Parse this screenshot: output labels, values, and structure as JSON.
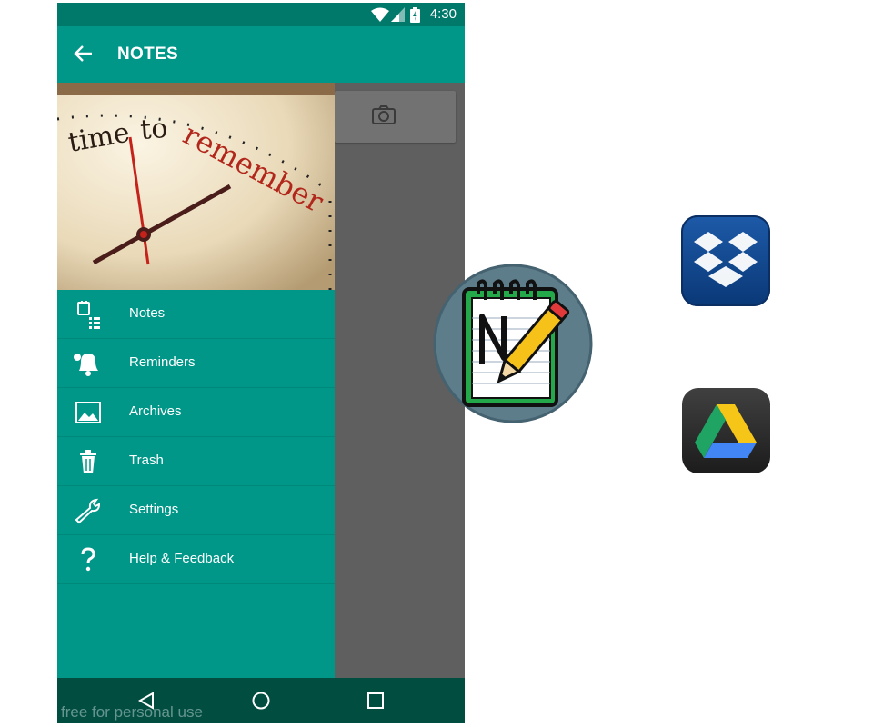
{
  "status_bar": {
    "time": "4:30"
  },
  "app_bar": {
    "title": "NOTES"
  },
  "drawer": {
    "header_image_text": "time to remember",
    "items": [
      {
        "label": "Notes",
        "icon": "notes-icon"
      },
      {
        "label": "Reminders",
        "icon": "bell-icon"
      },
      {
        "label": "Archives",
        "icon": "archive-icon"
      },
      {
        "label": "Trash",
        "icon": "trash-icon"
      },
      {
        "label": "Settings",
        "icon": "wrench-icon"
      },
      {
        "label": "Help & Feedback",
        "icon": "help-icon"
      }
    ]
  },
  "nav_bar": {
    "watermark": "free for personal use"
  },
  "external_icons": [
    {
      "name": "Notes app logo",
      "icon": "notepad-pencil-icon"
    },
    {
      "name": "Dropbox",
      "icon": "dropbox-icon"
    },
    {
      "name": "Google Drive",
      "icon": "google-drive-icon"
    }
  ],
  "colors": {
    "primary": "#009688",
    "primary_dark": "#00796b",
    "nav_bar": "#014d40",
    "scrim": "#5f5f5f"
  }
}
